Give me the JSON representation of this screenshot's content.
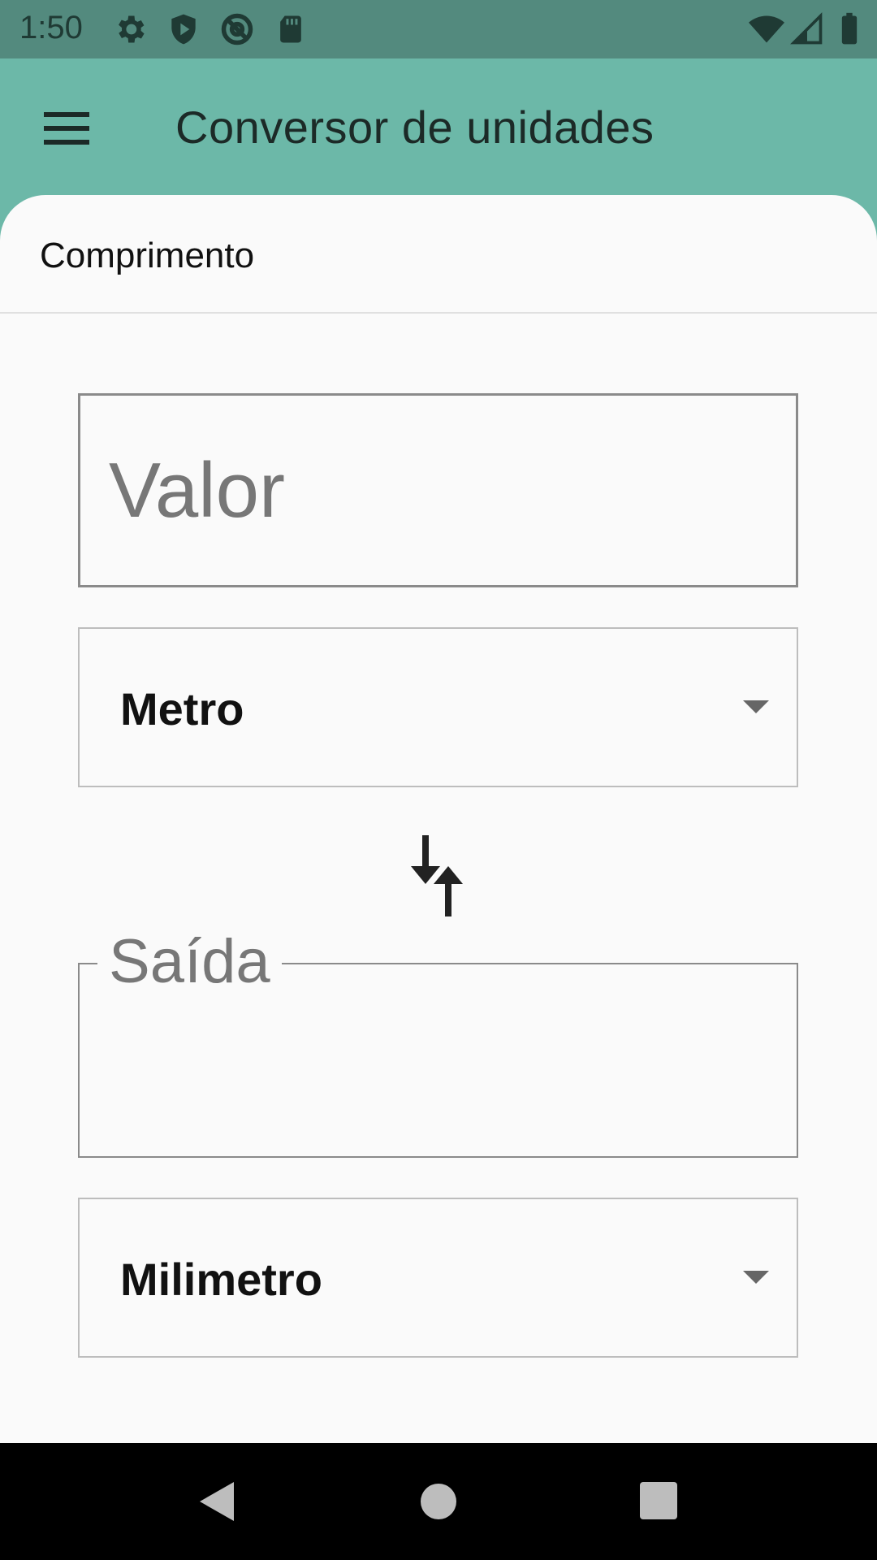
{
  "status_bar": {
    "time": "1:50",
    "left_icons": [
      "gear-icon",
      "shield-play-icon",
      "at-sign-icon",
      "sd-card-icon"
    ],
    "right_icons": [
      "wifi-icon",
      "signal-icon",
      "battery-icon"
    ]
  },
  "app_bar": {
    "menu_icon": "hamburger-menu-icon",
    "title": "Conversor de unidades",
    "color": "#6cb8a8"
  },
  "content": {
    "category_label": "Comprimento",
    "value_input": {
      "placeholder": "Valor",
      "value": ""
    },
    "from_unit": {
      "selected": "Metro"
    },
    "swap_icon": "swap-vertical-arrows-icon",
    "output_field": {
      "label": "Saída",
      "value": ""
    },
    "to_unit": {
      "selected": "Milimetro"
    }
  },
  "nav_bar": {
    "buttons": [
      "back-icon",
      "home-icon",
      "recents-icon"
    ]
  }
}
